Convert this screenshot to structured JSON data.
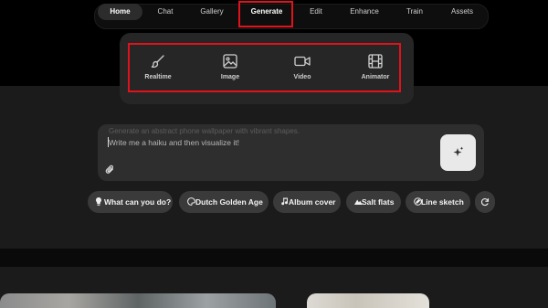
{
  "nav": {
    "items": [
      {
        "label": "Home"
      },
      {
        "label": "Chat"
      },
      {
        "label": "Gallery"
      },
      {
        "label": "Generate"
      },
      {
        "label": "Edit"
      },
      {
        "label": "Enhance"
      },
      {
        "label": "Train"
      },
      {
        "label": "Assets"
      }
    ],
    "active": "Home",
    "highlighted": "Generate"
  },
  "generate_menu": {
    "options": [
      {
        "label": "Realtime",
        "icon": "brush-icon"
      },
      {
        "label": "Image",
        "icon": "image-icon"
      },
      {
        "label": "Video",
        "icon": "video-camera-icon"
      },
      {
        "label": "Animator",
        "icon": "film-strip-icon"
      }
    ]
  },
  "prompt": {
    "placeholder": "Generate an abstract phone wallpaper with vibrant shapes.",
    "value": "Write me a haiku and then visualize it!"
  },
  "chips": [
    {
      "label": "What can you do?",
      "icon": "lightbulb-icon"
    },
    {
      "label": "Dutch Golden Age",
      "icon": "palette-icon"
    },
    {
      "label": "Album cover",
      "icon": "music-note-icon"
    },
    {
      "label": "Salt flats",
      "icon": "mountain-icon"
    },
    {
      "label": "Line sketch",
      "icon": "pencil-icon"
    }
  ],
  "colors": {
    "highlight": "#e0121b",
    "background": "#1b1b1b",
    "panel": "#262626",
    "chip": "#3a3a3a"
  }
}
